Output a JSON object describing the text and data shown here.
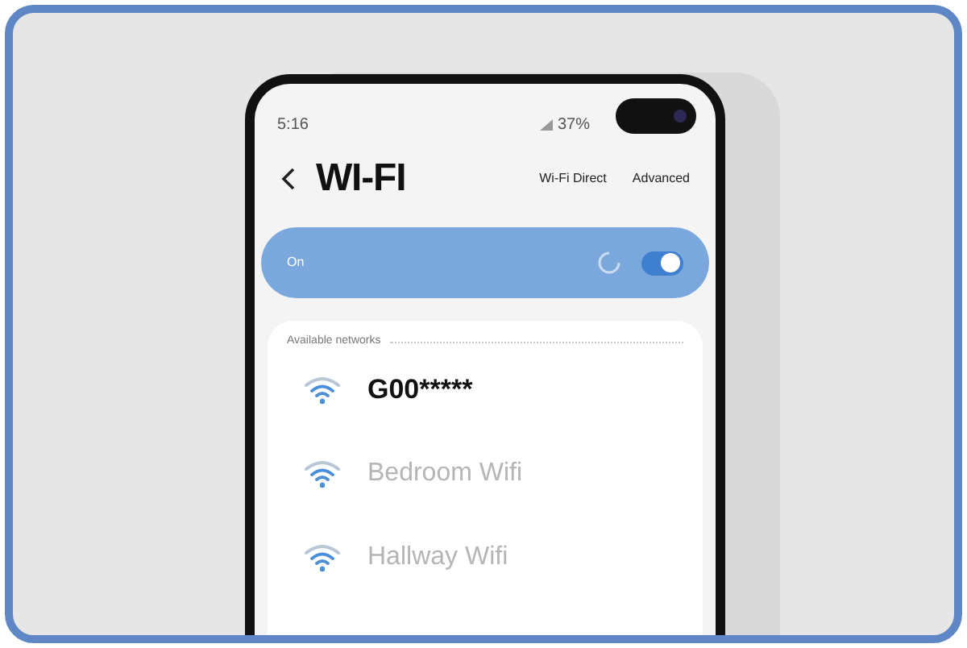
{
  "status_bar": {
    "time": "5:16",
    "battery": "37%"
  },
  "header": {
    "title": "WI-FI",
    "actions": [
      "Wi-Fi Direct",
      "Advanced"
    ]
  },
  "wifi_toggle": {
    "label": "On",
    "on": true
  },
  "networks": {
    "heading": "Available networks",
    "items": [
      {
        "name": "G00*****",
        "selected": true
      },
      {
        "name": "Bedroom Wifi",
        "selected": false
      },
      {
        "name": "Hallway Wifi",
        "selected": false
      }
    ]
  }
}
